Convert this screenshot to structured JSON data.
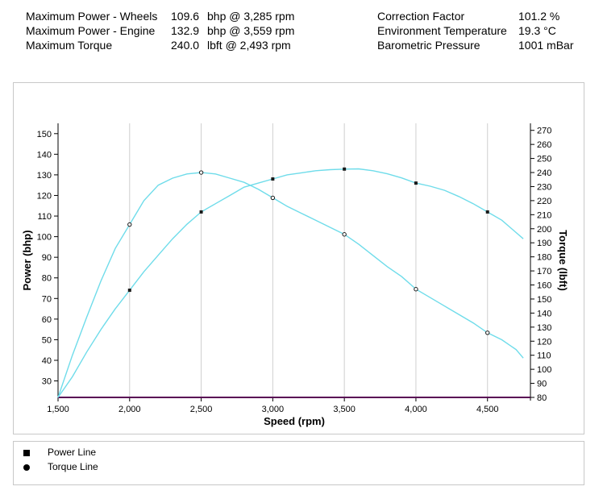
{
  "stats": {
    "left": [
      {
        "label": "Maximum Power - Wheels",
        "value": "109.6",
        "unit": "bhp @ 3,285 rpm"
      },
      {
        "label": "Maximum Power - Engine",
        "value": "132.9",
        "unit": "bhp @ 3,559 rpm"
      },
      {
        "label": "Maximum Torque",
        "value": "240.0",
        "unit": "lbft @ 2,493 rpm"
      }
    ],
    "right": [
      {
        "label": "Correction Factor",
        "value": "101.2 %"
      },
      {
        "label": "Environment Temperature",
        "value": "19.3 °C"
      },
      {
        "label": "Barometric Pressure",
        "value": "1001 mBar"
      }
    ]
  },
  "legend": {
    "power": "Power Line",
    "torque": "Torque Line"
  },
  "chart_data": {
    "type": "line",
    "xlabel": "Speed (rpm)",
    "ylabel": "Power (bhp)",
    "y2label": "Torque (lbft)",
    "xlim": [
      1500,
      4800
    ],
    "ylim": [
      22,
      155
    ],
    "y2lim": [
      80,
      275
    ],
    "x_ticks": [
      1500,
      2000,
      2500,
      3000,
      3500,
      4000,
      4500
    ],
    "x_tick_labels": [
      "1,500",
      "2,000",
      "2,500",
      "3,000",
      "3,500",
      "4,000",
      "4,500"
    ],
    "y_ticks": [
      30,
      40,
      50,
      60,
      70,
      80,
      90,
      100,
      110,
      120,
      130,
      140,
      150
    ],
    "y2_ticks": [
      80,
      90,
      100,
      110,
      120,
      130,
      140,
      150,
      160,
      170,
      180,
      190,
      200,
      210,
      220,
      230,
      240,
      250,
      260,
      270
    ],
    "grid": "vertical",
    "line_color": "#6fdcea",
    "baseline_color": "#5a0a55",
    "series": [
      {
        "name": "Power Line",
        "axis": "left",
        "marker": "square",
        "x": [
          1500,
          1600,
          1700,
          1800,
          1900,
          2000,
          2100,
          2200,
          2300,
          2400,
          2500,
          2600,
          2700,
          2800,
          2900,
          3000,
          3100,
          3200,
          3300,
          3400,
          3500,
          3600,
          3700,
          3800,
          3900,
          4000,
          4100,
          4200,
          4300,
          4400,
          4500,
          4600,
          4700,
          4750
        ],
        "values": [
          22,
          32,
          44,
          55,
          65,
          74,
          83,
          91,
          99,
          106,
          112,
          116,
          120,
          124,
          126,
          128,
          130,
          131,
          132,
          132.5,
          132.8,
          132.9,
          132,
          130.5,
          128.5,
          126,
          124.5,
          122.5,
          119.5,
          116,
          112,
          108,
          102,
          99
        ]
      },
      {
        "name": "Torque Line",
        "axis": "right",
        "marker": "circle",
        "x": [
          1500,
          1600,
          1700,
          1800,
          1900,
          2000,
          2100,
          2200,
          2300,
          2400,
          2500,
          2600,
          2700,
          2800,
          2900,
          3000,
          3100,
          3200,
          3300,
          3400,
          3500,
          3600,
          3700,
          3800,
          3900,
          4000,
          4100,
          4200,
          4300,
          4400,
          4500,
          4600,
          4700,
          4750
        ],
        "values": [
          80,
          110,
          137,
          163,
          186,
          203,
          220,
          231,
          236,
          239,
          240,
          239,
          236,
          233,
          228,
          222,
          216,
          211,
          206,
          201,
          196,
          189,
          181,
          173,
          166,
          157,
          151,
          145,
          139,
          133,
          126,
          121,
          114,
          108
        ]
      }
    ]
  }
}
